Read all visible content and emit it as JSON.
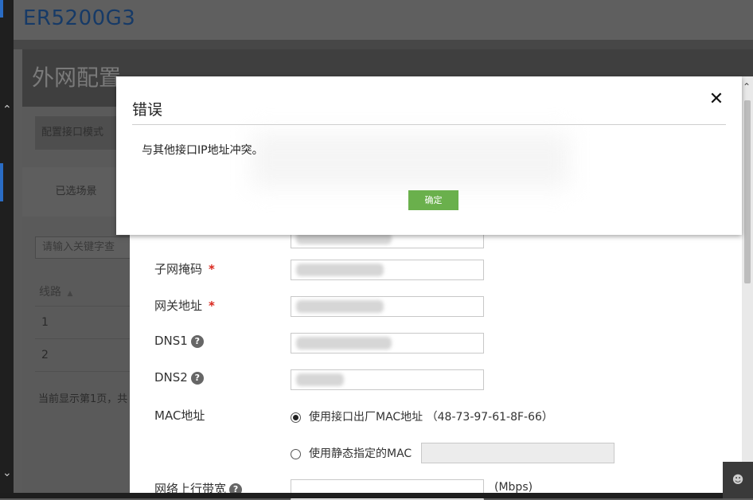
{
  "app": {
    "brand": "ER5200G3"
  },
  "section": {
    "title": "外网配置"
  },
  "background": {
    "mode_tab": "配置接口模式",
    "scene_label": "已选场景",
    "search_placeholder": "请输入关键字查",
    "table": {
      "header": "线路",
      "rows": [
        "1",
        "2"
      ]
    },
    "page_info": "当前显示第1页，共"
  },
  "form": {
    "subnet_mask_label": "子网掩码",
    "gateway_label": "网关地址",
    "dns1_label": "DNS1",
    "dns2_label": "DNS2",
    "mac_label": "MAC地址",
    "mac_option_factory": "使用接口出厂MAC地址 （48-73-97-61-8F-66）",
    "mac_option_static": "使用静态指定的MAC",
    "uplink_label": "网络上行带宽",
    "uplink_unit": "(Mbps)",
    "required_mark": "*",
    "help_glyph": "?"
  },
  "modal": {
    "title": "错误",
    "message": "与其他接口IP地址冲突。",
    "ok_label": "确定",
    "close_glyph": "✕"
  },
  "icons": {
    "scroll_up": "^",
    "scroll_down": "v",
    "sort": "▲",
    "user": "👤"
  },
  "colors": {
    "accent_green": "#6ab04c",
    "required_red": "#d9261c",
    "brand_blue": "#163a67"
  }
}
